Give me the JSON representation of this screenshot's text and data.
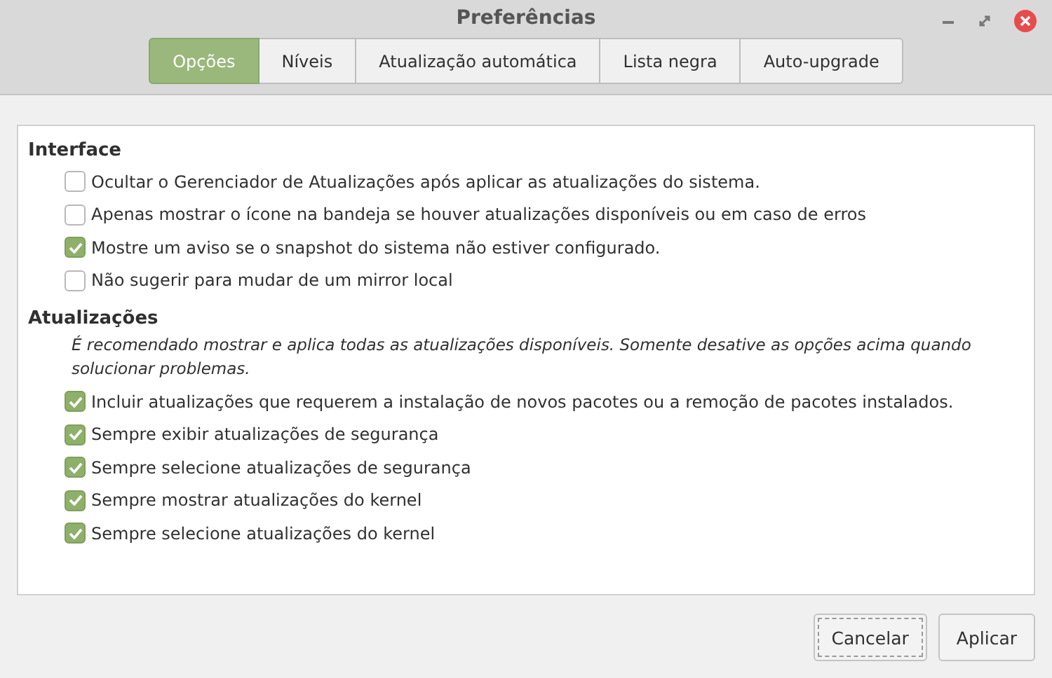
{
  "window": {
    "title": "Preferências"
  },
  "tabs": [
    {
      "label": "Opções",
      "selected": true
    },
    {
      "label": "Níveis",
      "selected": false
    },
    {
      "label": "Atualização automática",
      "selected": false
    },
    {
      "label": "Lista negra",
      "selected": false
    },
    {
      "label": "Auto-upgrade",
      "selected": false
    }
  ],
  "sections": [
    {
      "heading": "Interface",
      "options": [
        {
          "label": "Ocultar o Gerenciador de Atualizações após aplicar as atualizações do sistema.",
          "checked": false
        },
        {
          "label": "Apenas mostrar o ícone na bandeja se houver atualizações disponíveis ou em caso de erros",
          "checked": false
        },
        {
          "label": "Mostre um aviso se o snapshot do sistema não estiver configurado.",
          "checked": true
        },
        {
          "label": "Não sugerir para mudar de um mirror local",
          "checked": false
        }
      ]
    },
    {
      "heading": "Atualizações",
      "note": "É recomendado mostrar e aplica todas as atualizações disponíveis. Somente desative as opções acima quando solucionar problemas.",
      "options": [
        {
          "label": "Incluir atualizações que requerem a instalação de novos pacotes ou a remoção de pacotes instalados.",
          "checked": true
        },
        {
          "label": "Sempre exibir atualizações de segurança",
          "checked": true
        },
        {
          "label": "Sempre selecione atualizações de segurança",
          "checked": true
        },
        {
          "label": "Sempre mostrar atualizações do kernel",
          "checked": true
        },
        {
          "label": "Sempre selecione atualizações do kernel",
          "checked": true
        }
      ]
    }
  ],
  "buttons": [
    {
      "label": "Cancelar",
      "focused": true
    },
    {
      "label": "Aplicar",
      "focused": false
    }
  ]
}
